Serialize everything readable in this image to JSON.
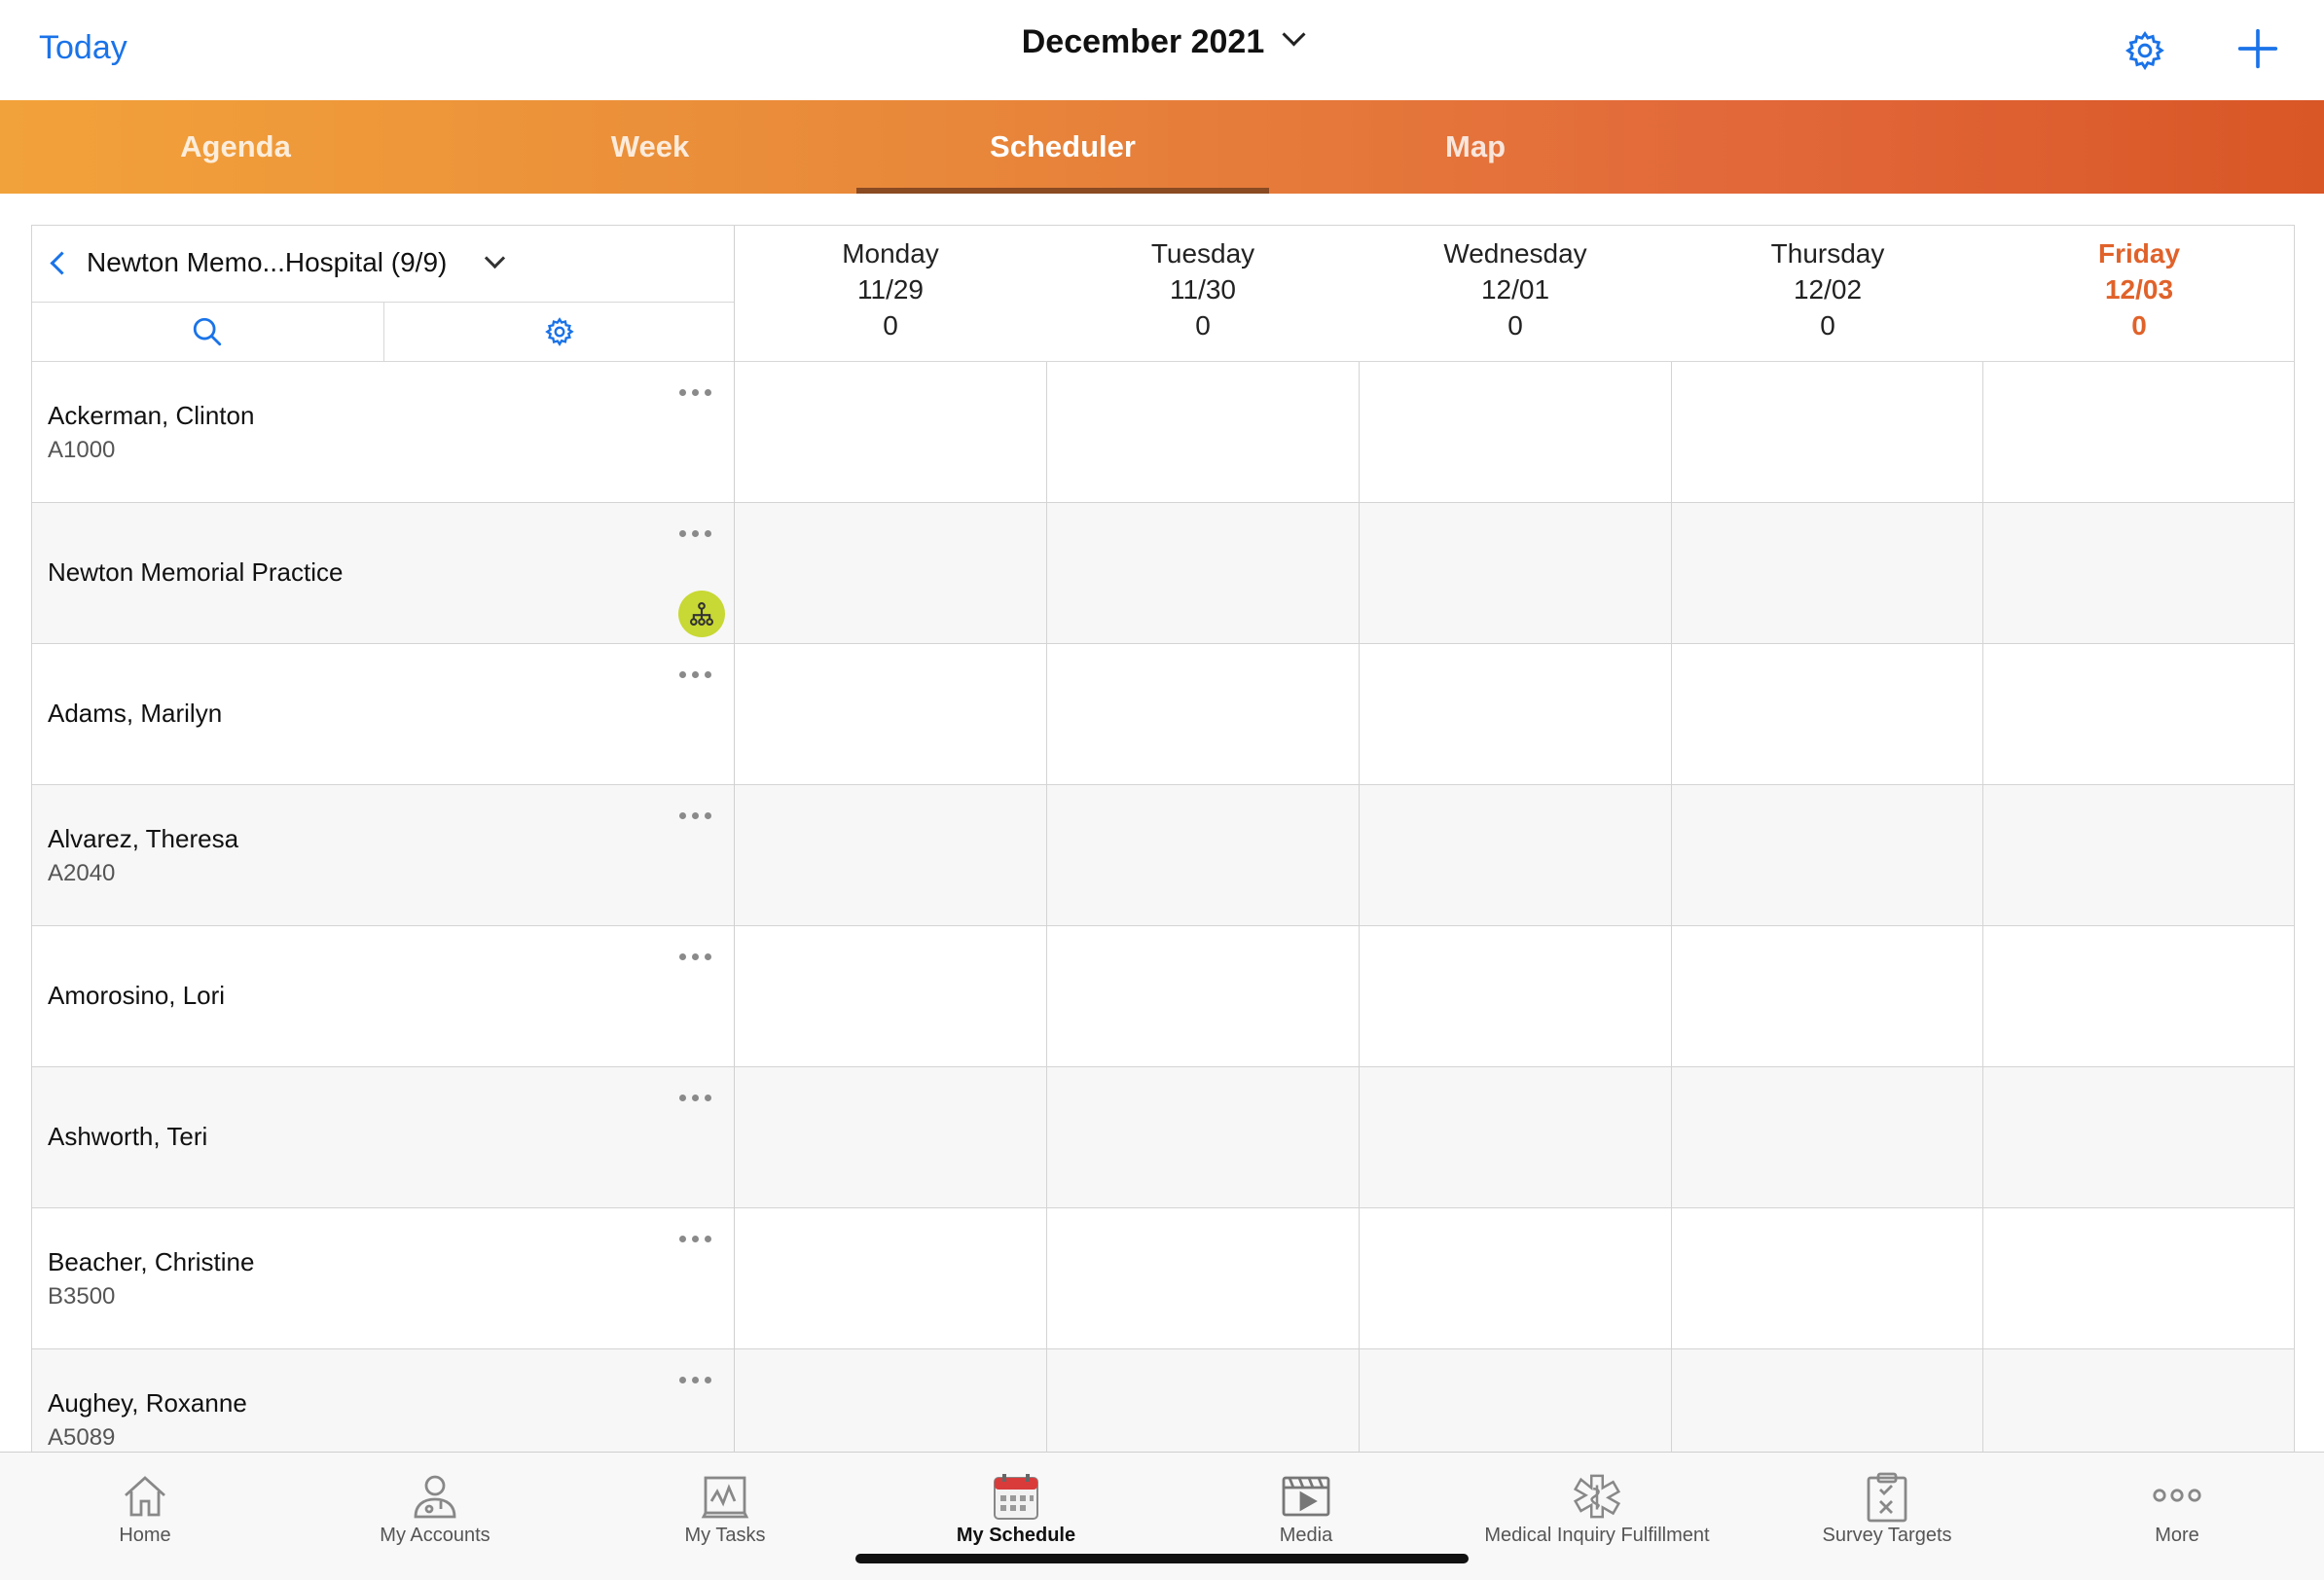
{
  "header": {
    "today_label": "Today",
    "month_label": "December 2021",
    "settings_icon": "gear-icon",
    "add_icon": "plus-icon"
  },
  "view_tabs": [
    {
      "label": "Agenda",
      "active": false
    },
    {
      "label": "Week",
      "active": false
    },
    {
      "label": "Scheduler",
      "active": true
    },
    {
      "label": "Map",
      "active": false
    }
  ],
  "account_selector": {
    "label": "Newton Memo...Hospital (9/9)"
  },
  "days": [
    {
      "name": "Monday",
      "date": "11/29",
      "count": "0",
      "is_today": false
    },
    {
      "name": "Tuesday",
      "date": "11/30",
      "count": "0",
      "is_today": false
    },
    {
      "name": "Wednesday",
      "date": "12/01",
      "count": "0",
      "is_today": false
    },
    {
      "name": "Thursday",
      "date": "12/02",
      "count": "0",
      "is_today": false
    },
    {
      "name": "Friday",
      "date": "12/03",
      "count": "0",
      "is_today": true
    }
  ],
  "accounts": [
    {
      "name": "Ackerman, Clinton",
      "code": "A1000"
    },
    {
      "name": "Newton Memorial Practice",
      "code": "",
      "hierarchy_icon": "hierarchy-icon"
    },
    {
      "name": "Adams, Marilyn",
      "code": ""
    },
    {
      "name": "Alvarez, Theresa",
      "code": "A2040"
    },
    {
      "name": "Amorosino, Lori",
      "code": ""
    },
    {
      "name": "Ashworth, Teri",
      "code": ""
    },
    {
      "name": "Beacher, Christine",
      "code": "B3500"
    },
    {
      "name": "Aughey, Roxanne",
      "code": "A5089"
    }
  ],
  "bottom_tabs": [
    {
      "label": "Home",
      "icon": "home-icon",
      "active": false
    },
    {
      "label": "My Accounts",
      "icon": "accounts-icon",
      "active": false
    },
    {
      "label": "My Tasks",
      "icon": "tasks-icon",
      "active": false
    },
    {
      "label": "My Schedule",
      "icon": "calendar-icon",
      "active": true
    },
    {
      "label": "Media",
      "icon": "media-icon",
      "active": false
    },
    {
      "label": "Medical Inquiry Fulfillment",
      "icon": "medical-icon",
      "active": false
    },
    {
      "label": "Survey Targets",
      "icon": "survey-icon",
      "active": false
    },
    {
      "label": "More",
      "icon": "more-icon",
      "active": false
    }
  ],
  "colors": {
    "accent_blue": "#1a73e8",
    "today_orange": "#e0622a",
    "hierarchy_badge": "#c8d834"
  }
}
